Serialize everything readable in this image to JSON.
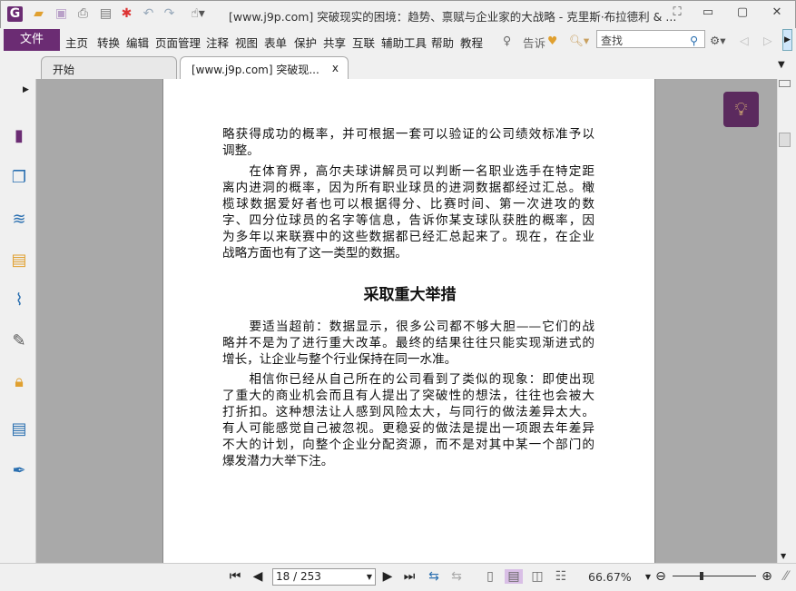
{
  "titlebar": {
    "title": "[www.j9p.com] 突破现实的困境：趋势、禀赋与企业家的大战略 - 克里斯·布拉德利 & ...",
    "logo": "G"
  },
  "menu": {
    "file": "文件",
    "items": [
      "主页",
      "转换",
      "编辑",
      "页面管理",
      "注释",
      "视图",
      "表单",
      "保护",
      "共享",
      "互联",
      "辅助工具",
      "帮助",
      "教程"
    ],
    "tell": "告诉",
    "search_placeholder": "查找"
  },
  "tabs": [
    {
      "label": "开始"
    },
    {
      "label": "[www.j9p.com] 突破现...",
      "close": "x"
    }
  ],
  "document": {
    "lines_p1": [
      "略获得成功的概率，并可根据一套可以验证的公司绩效标准予以",
      "调整。"
    ],
    "lines_p2": [
      "　　在体育界，高尔夫球讲解员可以判断一名职业选手在特定距",
      "离内进洞的概率，因为所有职业球员的进洞数据都经过汇总。橄",
      "榄球数据爱好者也可以根据得分、比赛时间、第一次进攻的数",
      "字、四分位球员的名字等信息，告诉你某支球队获胜的概率，因",
      "为多年以来联赛中的这些数据都已经汇总起来了。现在，在企业",
      "战略方面也有了这一类型的数据。"
    ],
    "heading": "采取重大举措",
    "lines_p3": [
      "　　要适当超前：数据显示，很多公司都不够大胆——它们的战",
      "略并不是为了进行重大改革。最终的结果往往只能实现渐进式的",
      "增长，让企业与整个行业保持在同一水准。"
    ],
    "lines_p4": [
      "　　相信你已经从自己所在的公司看到了类似的现象：即使出现",
      "了重大的商业机会而且有人提出了突破性的想法，往往也会被大",
      "打折扣。这种想法让人感到风险太大，与同行的做法差异太大。",
      "有人可能感觉自己被忽视。更稳妥的做法是提出一项跟去年差异",
      "不大的计划，向整个企业分配资源，而不是对其中某一个部门的",
      "爆发潜力大举下注。"
    ]
  },
  "statusbar": {
    "page": "18 / 253",
    "zoom": "66.67%"
  },
  "colors": {
    "accent": "#6b2c73",
    "viewer_bg": "#a9a9a9"
  }
}
